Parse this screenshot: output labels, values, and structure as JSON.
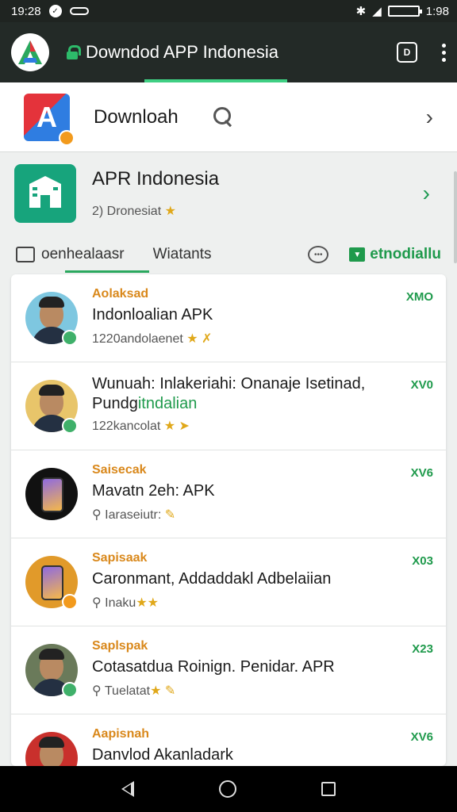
{
  "status_bar": {
    "time_left": "19:28",
    "time_right": "1:98",
    "battery": ""
  },
  "app_bar": {
    "title": "Downdod APP Indonesia",
    "tab_count": "D"
  },
  "search": {
    "label": "Downloah"
  },
  "app_header": {
    "name": "APR Indonesia",
    "subtitle": "2) Dronesiat",
    "star": "★"
  },
  "tabs": {
    "tab1": "oenhealaasr",
    "tab2": "Wiatants",
    "tab3": "etnodiallu"
  },
  "list": [
    {
      "category": "Aolaksad",
      "title": "Indonloalian APK",
      "meta": "1220andolaenet",
      "meta_icon": "★ ✗",
      "size": "XMO",
      "badge_color": "#3fb06a",
      "avatar_bg": "#7ec7e0"
    },
    {
      "category": "",
      "title": "Wunuah: Inlakeriahi: Onanaje Isetinad,",
      "title2_plain": "Pundg",
      "title2_green": "itndalian",
      "meta": "122kancolat",
      "meta_icon": "★ ➤",
      "size": "XV0",
      "badge_color": "#3fb06a",
      "avatar_bg": "#e8c56a"
    },
    {
      "category": "Saisecak",
      "title": "Mavatn 2eh: APK",
      "meta": "⚲ Iaraseiutr:",
      "meta_icon": "✎",
      "size": "XV6",
      "badge_color": "",
      "avatar_bg": "#111"
    },
    {
      "category": "Sapisaak",
      "title": "Caronmant, Addaddakl Adbelaiian",
      "meta": "⚲ Inaku",
      "meta_icon": "★★",
      "size": "X03",
      "badge_color": "#f29a1d",
      "avatar_bg": "#e19a2a"
    },
    {
      "category": "Saplspak",
      "title": "Cotasatdua Roinign. Penidar. APR",
      "meta": "⚲ Tuelatat",
      "meta_icon": "★ ✎",
      "size": "X23",
      "badge_color": "#3fb06a",
      "avatar_bg": "#6a7a5a"
    },
    {
      "category": "Aapisnah",
      "title": "Danvlod Akanladark",
      "meta": "",
      "meta_icon": "",
      "size": "XV6",
      "badge_color": "",
      "avatar_bg": "#c9302c"
    }
  ]
}
